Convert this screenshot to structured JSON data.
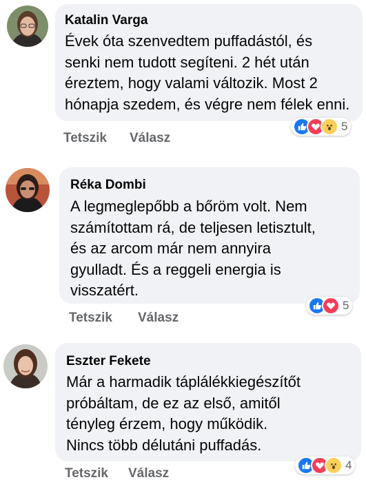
{
  "comments": [
    {
      "author": "Katalin Varga",
      "text": "Évek óta szenvedtem puffadástól, és\nsenki nem tudott segíteni. 2 hét után\néreztem, hogy valami változik. Most 2\nhónapja szedem, és végre nem félek enni.",
      "reactions": [
        "like-icon",
        "love-icon",
        "wow-icon"
      ],
      "reaction_count": "5",
      "like_label": "Tetszik",
      "reply_label": "Válasz"
    },
    {
      "author": "Réka Dombi",
      "text": "A legmeglepőbb a bőröm volt. Nem\nszámítottam rá, de teljesen letisztult,\nés az arcom már nem annyira\ngyulladt. És a reggeli energia is\nvisszatért.",
      "reactions": [
        "like-icon",
        "love-icon"
      ],
      "reaction_count": "5",
      "like_label": "Tetszik",
      "reply_label": "Válasz"
    },
    {
      "author": "Eszter Fekete",
      "text": "Már a harmadik táplálékkiegészítőt\npróbáltam, de ez az első, amitől\ntényleg érzem, hogy működik.\nNincs több délutáni puffadás.",
      "reactions": [
        "like-icon",
        "love-icon",
        "wow-icon"
      ],
      "reaction_count": "4",
      "like_label": "Tetszik",
      "reply_label": "Válasz"
    }
  ],
  "colors": {
    "bubble": "#f0f2f5",
    "like": "#1877f2",
    "love": "#f33e58",
    "wow": "#fcd05b",
    "muted_text": "#65676b"
  }
}
